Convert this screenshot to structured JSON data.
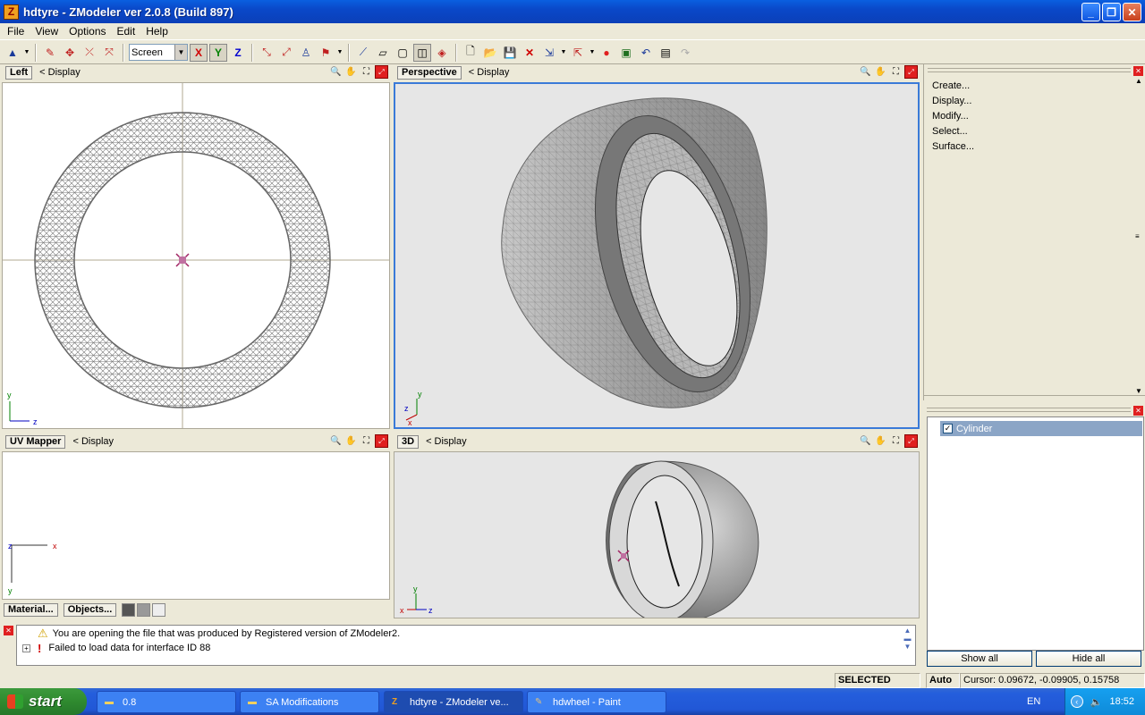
{
  "window": {
    "title": "hdtyre - ZModeler ver 2.0.8 (Build 897)"
  },
  "menu": [
    "File",
    "View",
    "Options",
    "Edit",
    "Help"
  ],
  "toolbar": {
    "coord_mode": "Screen",
    "axis_x": "X",
    "axis_y": "Y",
    "axis_z": "Z"
  },
  "viewports": {
    "left": {
      "title": "Left",
      "menu": "<  Display"
    },
    "perspective": {
      "title": "Perspective",
      "menu": "<  Display"
    },
    "uvmapper": {
      "title": "UV Mapper",
      "menu": "<  Display"
    },
    "three_d": {
      "title": "3D",
      "menu": "<  Display"
    }
  },
  "uv_tabs": {
    "material": "Material...",
    "objects": "Objects..."
  },
  "command_panel": {
    "items": [
      "Create...",
      "Display...",
      "Modify...",
      "Select...",
      "Surface..."
    ]
  },
  "objects_panel": {
    "items": [
      {
        "name": "Cylinder",
        "checked": true
      }
    ],
    "show_all": "Show all",
    "hide_all": "Hide all"
  },
  "log": {
    "messages": [
      "You are opening the file that was produced by Registered version of ZModeler2.",
      "Failed to load data for interface ID 88"
    ]
  },
  "status": {
    "mode": "SELECTED MODE",
    "auto": "Auto",
    "cursor": "Cursor: 0.09672, -0.09905, 0.15758"
  },
  "taskbar": {
    "start": "start",
    "tasks": [
      {
        "label": "0.8"
      },
      {
        "label": "SA Modifications"
      },
      {
        "label": "hdtyre - ZModeler ve..."
      },
      {
        "label": "hdwheel - Paint"
      }
    ],
    "lang": "EN",
    "clock": "18:52"
  },
  "axis_labels": {
    "x": "x",
    "y": "y",
    "z": "z"
  },
  "colors": {
    "title_blue": "#0a48c8",
    "taskbar_blue": "#245edc",
    "start_green": "#2f8a2f",
    "selection": "#8ba5c6"
  }
}
